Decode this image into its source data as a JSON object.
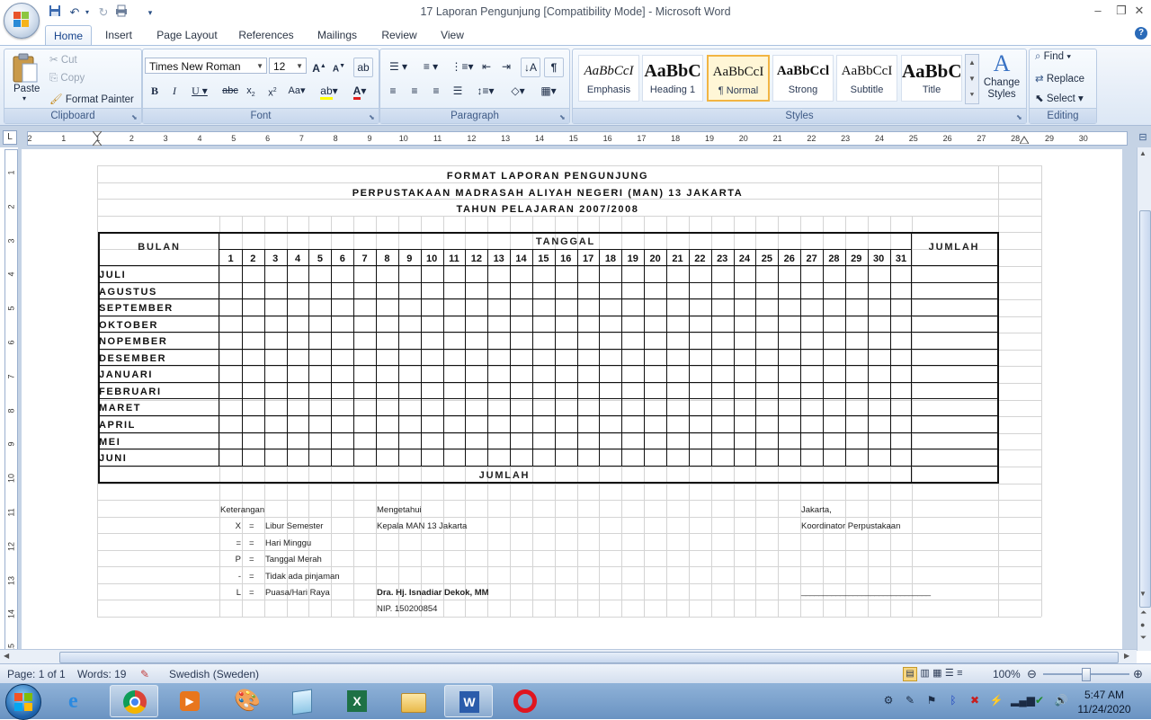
{
  "window": {
    "title": "17 Laporan Pengunjung [Compatibility Mode] - Microsoft Word",
    "controls": [
      "–",
      "❐",
      "✕"
    ]
  },
  "quick_access": [
    "save-icon",
    "undo-icon",
    "redo-icon",
    "print-icon"
  ],
  "tabs": [
    {
      "label": "Home",
      "active": true
    },
    {
      "label": "Insert"
    },
    {
      "label": "Page Layout"
    },
    {
      "label": "References"
    },
    {
      "label": "Mailings"
    },
    {
      "label": "Review"
    },
    {
      "label": "View"
    }
  ],
  "ribbon": {
    "clipboard": {
      "label": "Clipboard",
      "paste": "Paste",
      "cut": "Cut",
      "copy": "Copy",
      "format_painter": "Format Painter"
    },
    "font": {
      "label": "Font",
      "font_name": "Times New Roman",
      "font_size": "12"
    },
    "paragraph": {
      "label": "Paragraph"
    },
    "styles": {
      "label": "Styles",
      "items": [
        {
          "sample": "AaBbCcI",
          "name": "Emphasis"
        },
        {
          "sample": "AaBbC",
          "name": "Heading 1"
        },
        {
          "sample": "AaBbCcI",
          "name": "¶ Normal",
          "selected": true
        },
        {
          "sample": "AaBbCcl",
          "name": "Strong"
        },
        {
          "sample": "AaBbCcI",
          "name": "Subtitle"
        },
        {
          "sample": "AaBbC",
          "name": "Title"
        }
      ],
      "change_styles": "Change Styles"
    },
    "editing": {
      "label": "Editing",
      "find": "Find",
      "replace": "Replace",
      "select": "Select"
    }
  },
  "ruler": {
    "numbers": [
      "2",
      "1",
      "1",
      "2",
      "3",
      "4",
      "5",
      "6",
      "7",
      "8",
      "9",
      "10",
      "11",
      "12",
      "13",
      "14",
      "15",
      "16",
      "17",
      "18",
      "19",
      "20",
      "21",
      "22",
      "23",
      "24",
      "25",
      "26",
      "27",
      "28",
      "29",
      "30"
    ],
    "vnumbers": [
      "1",
      "2",
      "3",
      "4",
      "5",
      "6",
      "7",
      "8",
      "9",
      "10",
      "11",
      "12",
      "13",
      "14",
      "15",
      "16"
    ]
  },
  "document": {
    "title_lines": [
      "FORMAT LAPORAN PENGUNJUNG",
      "PERPUSTAKAAN MADRASAH ALIYAH NEGERI (MAN) 13 JAKARTA",
      "TAHUN PELAJARAN 2007/2008"
    ],
    "table": {
      "bulan_header": "BULAN",
      "tanggal_header": "TANGGAL",
      "jumlah_header": "JUMLAH",
      "days": [
        "1",
        "2",
        "3",
        "4",
        "5",
        "6",
        "7",
        "8",
        "9",
        "10",
        "11",
        "12",
        "13",
        "14",
        "15",
        "16",
        "17",
        "18",
        "19",
        "20",
        "21",
        "22",
        "23",
        "24",
        "25",
        "26",
        "27",
        "28",
        "29",
        "30",
        "31"
      ],
      "months": [
        "JULI",
        "AGUSTUS",
        "SEPTEMBER",
        "OKTOBER",
        "NOPEMBER",
        "DESEMBER",
        "JANUARI",
        "FEBRUARI",
        "MARET",
        "APRIL",
        "MEI",
        "JUNI"
      ],
      "footer_total": "JUMLAH"
    },
    "keterangan": {
      "label": "Keterangan",
      "items": [
        {
          "symbol": "X",
          "eq": "=",
          "desc": "Libur Semester"
        },
        {
          "symbol": "=",
          "eq": "=",
          "desc": "Hari Minggu"
        },
        {
          "symbol": "P",
          "eq": "=",
          "desc": "Tanggal Merah"
        },
        {
          "symbol": "-",
          "eq": "=",
          "desc": "Tidak ada pinjaman"
        },
        {
          "symbol": "L",
          "eq": "=",
          "desc": "Puasa/Hari Raya"
        }
      ]
    },
    "mengetahui": {
      "label": "Mengetahui",
      "role": "Kepala MAN 13 Jakarta",
      "name": "Dra. Hj. Isnadiar Dekok, MM",
      "nip": "NIP. 150200854"
    },
    "coordinator": {
      "place": "Jakarta,",
      "role": "Koordinator Perpustakaan",
      "signature_line": "______________________________"
    }
  },
  "status": {
    "page": "Page: 1 of 1",
    "words": "Words: 19",
    "language": "Swedish (Sweden)",
    "zoom": "100%"
  },
  "clock": {
    "time": "5:47 AM",
    "date": "11/24/2020"
  }
}
